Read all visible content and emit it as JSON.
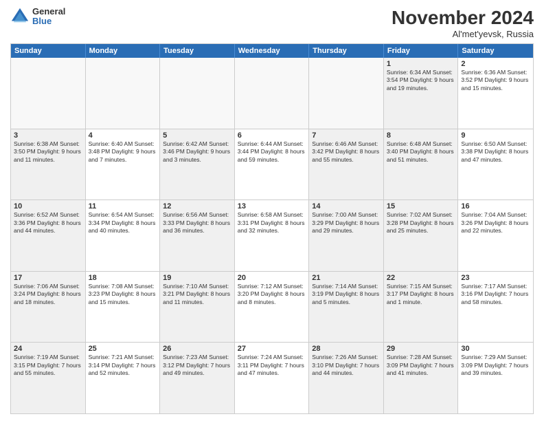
{
  "logo": {
    "general": "General",
    "blue": "Blue"
  },
  "title": "November 2024",
  "location": "Al'met'yevsk, Russia",
  "days": [
    "Sunday",
    "Monday",
    "Tuesday",
    "Wednesday",
    "Thursday",
    "Friday",
    "Saturday"
  ],
  "rows": [
    [
      {
        "day": "",
        "text": "",
        "empty": true
      },
      {
        "day": "",
        "text": "",
        "empty": true
      },
      {
        "day": "",
        "text": "",
        "empty": true
      },
      {
        "day": "",
        "text": "",
        "empty": true
      },
      {
        "day": "",
        "text": "",
        "empty": true
      },
      {
        "day": "1",
        "text": "Sunrise: 6:34 AM\nSunset: 3:54 PM\nDaylight: 9 hours\nand 19 minutes.",
        "shaded": true
      },
      {
        "day": "2",
        "text": "Sunrise: 6:36 AM\nSunset: 3:52 PM\nDaylight: 9 hours\nand 15 minutes.",
        "shaded": false
      }
    ],
    [
      {
        "day": "3",
        "text": "Sunrise: 6:38 AM\nSunset: 3:50 PM\nDaylight: 9 hours\nand 11 minutes.",
        "shaded": true
      },
      {
        "day": "4",
        "text": "Sunrise: 6:40 AM\nSunset: 3:48 PM\nDaylight: 9 hours\nand 7 minutes."
      },
      {
        "day": "5",
        "text": "Sunrise: 6:42 AM\nSunset: 3:46 PM\nDaylight: 9 hours\nand 3 minutes.",
        "shaded": true
      },
      {
        "day": "6",
        "text": "Sunrise: 6:44 AM\nSunset: 3:44 PM\nDaylight: 8 hours\nand 59 minutes."
      },
      {
        "day": "7",
        "text": "Sunrise: 6:46 AM\nSunset: 3:42 PM\nDaylight: 8 hours\nand 55 minutes.",
        "shaded": true
      },
      {
        "day": "8",
        "text": "Sunrise: 6:48 AM\nSunset: 3:40 PM\nDaylight: 8 hours\nand 51 minutes.",
        "shaded": true
      },
      {
        "day": "9",
        "text": "Sunrise: 6:50 AM\nSunset: 3:38 PM\nDaylight: 8 hours\nand 47 minutes."
      }
    ],
    [
      {
        "day": "10",
        "text": "Sunrise: 6:52 AM\nSunset: 3:36 PM\nDaylight: 8 hours\nand 44 minutes.",
        "shaded": true
      },
      {
        "day": "11",
        "text": "Sunrise: 6:54 AM\nSunset: 3:34 PM\nDaylight: 8 hours\nand 40 minutes."
      },
      {
        "day": "12",
        "text": "Sunrise: 6:56 AM\nSunset: 3:33 PM\nDaylight: 8 hours\nand 36 minutes.",
        "shaded": true
      },
      {
        "day": "13",
        "text": "Sunrise: 6:58 AM\nSunset: 3:31 PM\nDaylight: 8 hours\nand 32 minutes."
      },
      {
        "day": "14",
        "text": "Sunrise: 7:00 AM\nSunset: 3:29 PM\nDaylight: 8 hours\nand 29 minutes.",
        "shaded": true
      },
      {
        "day": "15",
        "text": "Sunrise: 7:02 AM\nSunset: 3:28 PM\nDaylight: 8 hours\nand 25 minutes.",
        "shaded": true
      },
      {
        "day": "16",
        "text": "Sunrise: 7:04 AM\nSunset: 3:26 PM\nDaylight: 8 hours\nand 22 minutes."
      }
    ],
    [
      {
        "day": "17",
        "text": "Sunrise: 7:06 AM\nSunset: 3:24 PM\nDaylight: 8 hours\nand 18 minutes.",
        "shaded": true
      },
      {
        "day": "18",
        "text": "Sunrise: 7:08 AM\nSunset: 3:23 PM\nDaylight: 8 hours\nand 15 minutes."
      },
      {
        "day": "19",
        "text": "Sunrise: 7:10 AM\nSunset: 3:21 PM\nDaylight: 8 hours\nand 11 minutes.",
        "shaded": true
      },
      {
        "day": "20",
        "text": "Sunrise: 7:12 AM\nSunset: 3:20 PM\nDaylight: 8 hours\nand 8 minutes."
      },
      {
        "day": "21",
        "text": "Sunrise: 7:14 AM\nSunset: 3:19 PM\nDaylight: 8 hours\nand 5 minutes.",
        "shaded": true
      },
      {
        "day": "22",
        "text": "Sunrise: 7:15 AM\nSunset: 3:17 PM\nDaylight: 8 hours\nand 1 minute.",
        "shaded": true
      },
      {
        "day": "23",
        "text": "Sunrise: 7:17 AM\nSunset: 3:16 PM\nDaylight: 7 hours\nand 58 minutes."
      }
    ],
    [
      {
        "day": "24",
        "text": "Sunrise: 7:19 AM\nSunset: 3:15 PM\nDaylight: 7 hours\nand 55 minutes.",
        "shaded": true
      },
      {
        "day": "25",
        "text": "Sunrise: 7:21 AM\nSunset: 3:14 PM\nDaylight: 7 hours\nand 52 minutes."
      },
      {
        "day": "26",
        "text": "Sunrise: 7:23 AM\nSunset: 3:12 PM\nDaylight: 7 hours\nand 49 minutes.",
        "shaded": true
      },
      {
        "day": "27",
        "text": "Sunrise: 7:24 AM\nSunset: 3:11 PM\nDaylight: 7 hours\nand 47 minutes."
      },
      {
        "day": "28",
        "text": "Sunrise: 7:26 AM\nSunset: 3:10 PM\nDaylight: 7 hours\nand 44 minutes.",
        "shaded": true
      },
      {
        "day": "29",
        "text": "Sunrise: 7:28 AM\nSunset: 3:09 PM\nDaylight: 7 hours\nand 41 minutes.",
        "shaded": true
      },
      {
        "day": "30",
        "text": "Sunrise: 7:29 AM\nSunset: 3:09 PM\nDaylight: 7 hours\nand 39 minutes."
      }
    ]
  ]
}
